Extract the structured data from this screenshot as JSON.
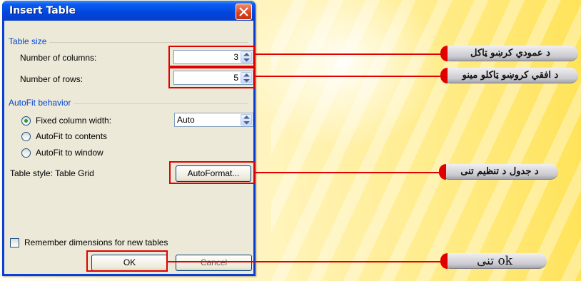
{
  "dialog": {
    "title": "Insert Table",
    "table_size": {
      "group_label": "Table size",
      "columns_label": "Number of columns:",
      "columns_value": "3",
      "rows_label": "Number of rows:",
      "rows_value": "5"
    },
    "autofit": {
      "group_label": "AutoFit behavior",
      "fixed_label": "Fixed column width:",
      "fixed_value": "Auto",
      "contents_label": "AutoFit to contents",
      "window_label": "AutoFit to window"
    },
    "table_style_label": "Table style: Table Grid",
    "autoformat_label": "AutoFormat...",
    "remember_label": "Remember dimensions for new tables",
    "ok_label": "OK",
    "cancel_label": "Cancel"
  },
  "callouts": {
    "columns": "د عمودي کرښو ټاکل",
    "rows": "د افقي کروښو ټاکلو مینو",
    "style": "د جدول د تنظیم تنی",
    "ok": "ok تنی"
  },
  "colors": {
    "highlight": "#e00000",
    "titlebar": "#0046de",
    "dialog_bg": "#ece9d8",
    "group_label": "#0046d5"
  }
}
